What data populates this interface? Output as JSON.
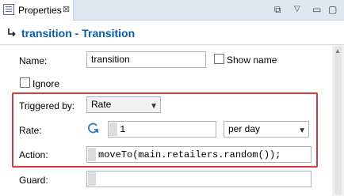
{
  "tab": {
    "title": "Properties",
    "close": "⊠"
  },
  "toolbar": {
    "pin": "⧉",
    "menu": "▽",
    "minimize": "▭",
    "maximize": "▢"
  },
  "header": {
    "title": "transition - Transition"
  },
  "fields": {
    "name_label": "Name:",
    "name_value": "transition",
    "show_name_label": "Show name",
    "ignore_label": "Ignore",
    "triggered_by_label": "Triggered by:",
    "triggered_by_value": "Rate",
    "rate_label": "Rate:",
    "rate_value": "1",
    "rate_unit": "per day",
    "action_label": "Action:",
    "action_value": "moveTo(main.retailers.random());",
    "guard_label": "Guard:",
    "guard_value": ""
  },
  "colors": {
    "accent": "#0b5aa8",
    "highlight": "#d9393a"
  }
}
